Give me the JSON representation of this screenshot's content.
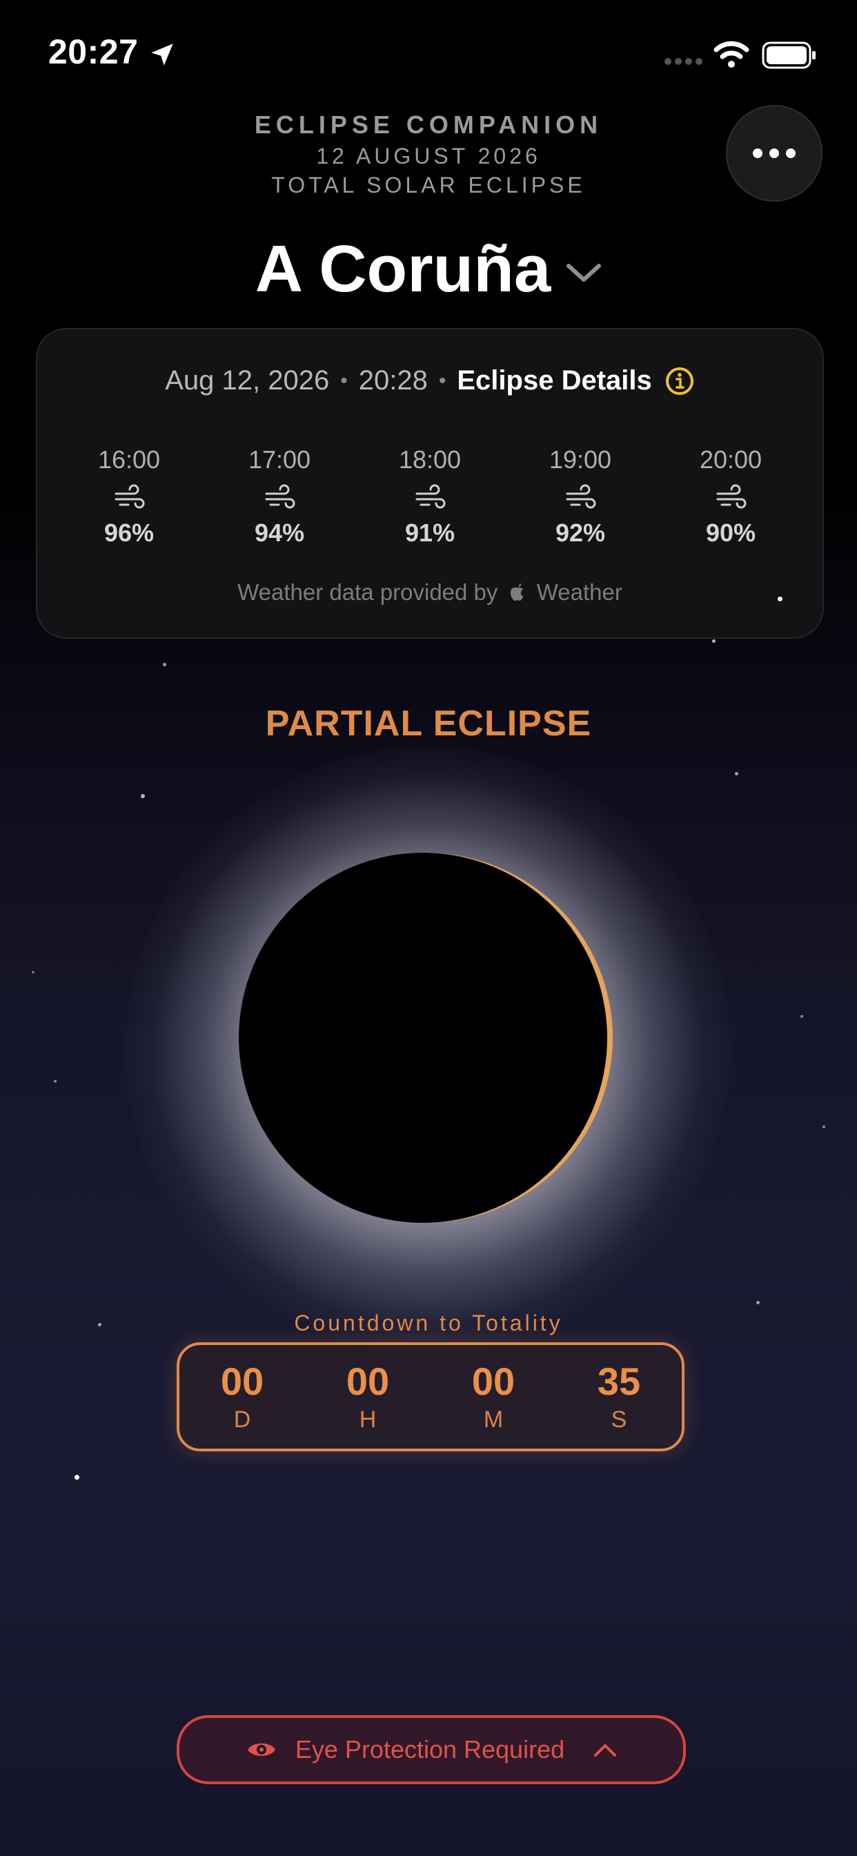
{
  "status_bar": {
    "time": "20:27",
    "icons": [
      "location-arrow-icon",
      "cellular-signal-icon",
      "wifi-icon",
      "battery-icon"
    ]
  },
  "header": {
    "app_title": "ECLIPSE COMPANION",
    "event_date": "12 AUGUST 2026",
    "event_type": "TOTAL SOLAR ECLIPSE",
    "more_button_icon": "ellipsis-icon"
  },
  "location": {
    "city": "A Coruña",
    "chevron_icon": "chevron-down-icon"
  },
  "weather_card": {
    "date": "Aug 12, 2026",
    "separator": "•",
    "time": "20:28",
    "details_label": "Eclipse Details",
    "info_icon": "info-icon",
    "hours": [
      {
        "time": "16:00",
        "icon": "wind-icon",
        "value": "96%"
      },
      {
        "time": "17:00",
        "icon": "wind-icon",
        "value": "94%"
      },
      {
        "time": "18:00",
        "icon": "wind-icon",
        "value": "91%"
      },
      {
        "time": "19:00",
        "icon": "wind-icon",
        "value": "92%"
      },
      {
        "time": "20:00",
        "icon": "wind-icon",
        "value": "90%"
      }
    ],
    "attribution_prefix": "Weather data provided by",
    "attribution_suffix": "Weather"
  },
  "eclipse": {
    "phase": "PARTIAL ECLIPSE"
  },
  "countdown": {
    "label": "Countdown to Totality",
    "units": [
      {
        "value": "00",
        "unit": "D"
      },
      {
        "value": "00",
        "unit": "H"
      },
      {
        "value": "00",
        "unit": "M"
      },
      {
        "value": "35",
        "unit": "S"
      }
    ]
  },
  "eye_protection": {
    "label": "Eye Protection Required",
    "icon": "eye-warning-icon",
    "chevron_icon": "chevron-up-icon"
  },
  "colors": {
    "accent_orange": "#e08b45",
    "warning_red": "#e0524a",
    "info_yellow": "#f2c12e"
  }
}
